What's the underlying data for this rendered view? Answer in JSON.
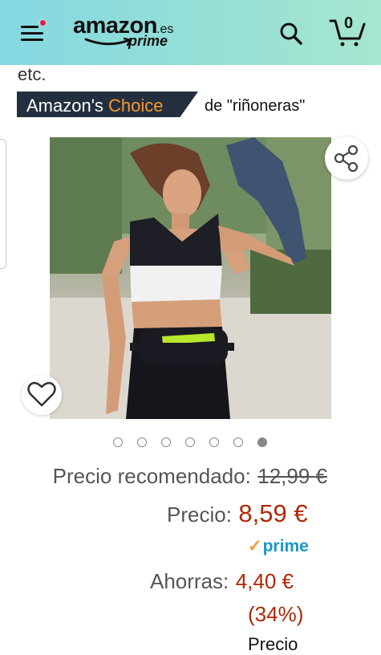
{
  "header": {
    "logo_word": "amazon",
    "logo_tld": ".es",
    "logo_prime": "prime",
    "cart_count": "0"
  },
  "colors": {
    "header_gradient_start": "#84d8e1",
    "header_gradient_end": "#a6e6cf",
    "badge_bg": "#232f3e",
    "badge_accent": "#f69931",
    "price_red": "#b12704",
    "prime_blue": "#1a98c6",
    "notification_dot": "#e41e5c"
  },
  "icons": [
    "menu-icon",
    "search-icon",
    "cart-icon",
    "share-icon",
    "heart-icon"
  ],
  "content": {
    "prev_text": "etc.",
    "badge_main": "Amazon's ",
    "badge_accent": "Choice",
    "badge_category": "de \"riñoneras\""
  },
  "carousel": {
    "dot_count": 7,
    "active_index": 6
  },
  "pricing": {
    "list_label": "Precio recomendado:",
    "list_price": "12,99 €",
    "price_label": "Precio:",
    "price": "8,59 €",
    "prime_label": "prime",
    "savings_label": "Ahorras:",
    "savings_amount": "4,40 €",
    "savings_percent": "(34%)",
    "next_label_partial": "Precio"
  }
}
